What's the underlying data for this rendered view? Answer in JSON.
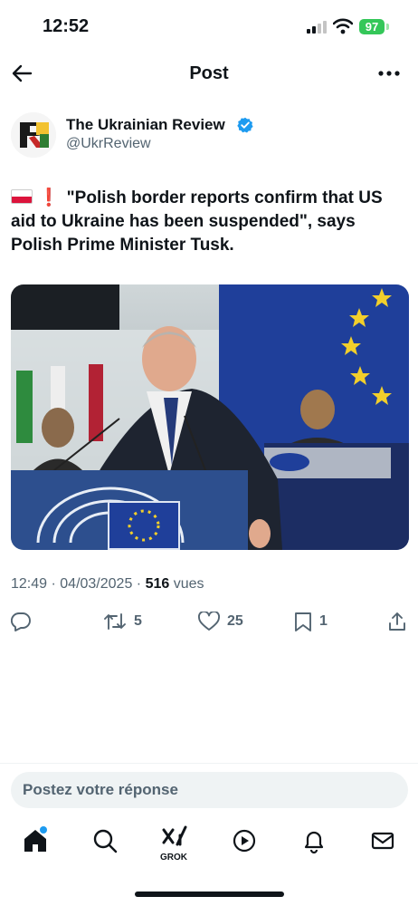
{
  "status_bar": {
    "time": "12:52",
    "battery": "97"
  },
  "header": {
    "title": "Post"
  },
  "author": {
    "name": "The Ukrainian Review",
    "handle": "@UkrReview"
  },
  "tweet": {
    "text": "\"Polish border reports confirm that US aid to Ukraine has been suspended\", says Polish Prime Minister Tusk."
  },
  "meta": {
    "time": "12:49",
    "separator": " · ",
    "date": "04/03/2025",
    "views_count": "516",
    "views_label": " vues"
  },
  "actions": {
    "retweets": "5",
    "likes": "25",
    "bookmarks": "1"
  },
  "reply": {
    "placeholder": "Postez votre réponse"
  },
  "nav": {
    "grok_label": "GROK"
  },
  "colors": {
    "accent": "#1d9bf0",
    "battery": "#34c759",
    "eu_blue": "#1f3f9a"
  }
}
